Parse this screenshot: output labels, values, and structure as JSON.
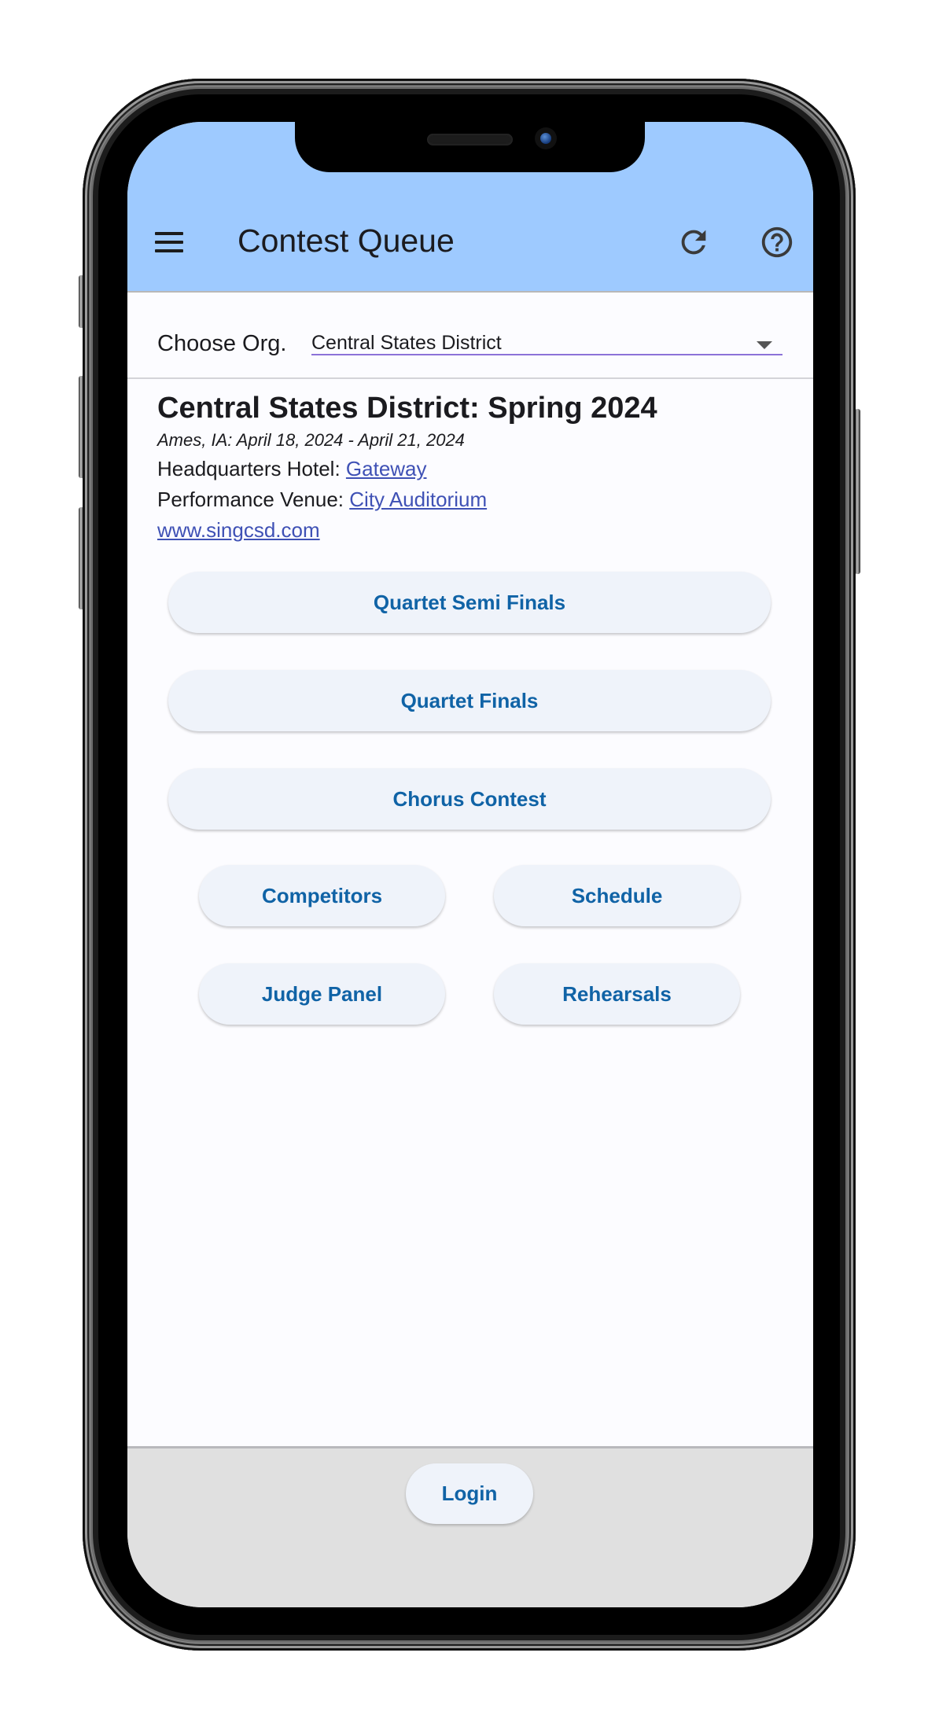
{
  "app": {
    "title": "Contest Queue",
    "icons": {
      "menu": "hamburger-menu-icon",
      "refresh": "refresh-icon",
      "help": "help-circle-icon"
    }
  },
  "org_selector": {
    "label": "Choose Org.",
    "selected": "Central States District"
  },
  "event": {
    "title": "Central States District: Spring 2024",
    "dates": "Ames, IA: April 18, 2024 - April 21, 2024",
    "hotel_label": "Headquarters Hotel: ",
    "hotel_link": "Gateway",
    "venue_label": "Performance Venue: ",
    "venue_link": "City Auditorium",
    "website": "www.singcsd.com"
  },
  "buttons": {
    "quartet_semi_finals": "Quartet Semi Finals",
    "quartet_finals": "Quartet Finals",
    "chorus_contest": "Chorus Contest",
    "competitors": "Competitors",
    "schedule": "Schedule",
    "judge_panel": "Judge Panel",
    "rehearsals": "Rehearsals"
  },
  "footer": {
    "login": "Login"
  },
  "colors": {
    "appbar": "#9ecaff",
    "button_text": "#1063a6",
    "button_bg": "#eff3fa",
    "link": "#3f51b5",
    "dropdown_underline": "#8c72d8",
    "footer_bg": "#e0e0e0"
  }
}
